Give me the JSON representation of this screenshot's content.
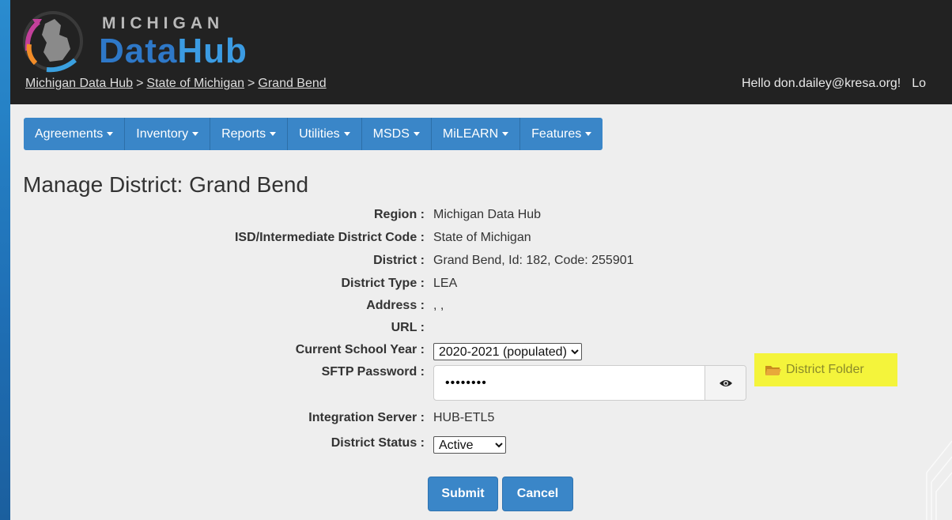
{
  "logo": {
    "line1": "MICHIGAN",
    "line2a": "Data",
    "line2b": "Hub"
  },
  "breadcrumb": {
    "items": [
      "Michigan Data Hub",
      "State of Michigan",
      "Grand Bend"
    ],
    "separator": ">"
  },
  "user": {
    "greeting": "Hello don.dailey@kresa.org!",
    "logout": "Lo"
  },
  "nav": {
    "items": [
      "Agreements",
      "Inventory",
      "Reports",
      "Utilities",
      "MSDS",
      "MiLEARN",
      "Features"
    ]
  },
  "page": {
    "title": "Manage District: Grand Bend"
  },
  "form": {
    "region": {
      "label": "Region :",
      "value": "Michigan Data Hub"
    },
    "isd": {
      "label": "ISD/Intermediate District Code :",
      "value": "State of Michigan"
    },
    "district": {
      "label": "District :",
      "value": "Grand Bend, Id: 182, Code: 255901"
    },
    "district_type": {
      "label": "District Type :",
      "value": "LEA"
    },
    "address": {
      "label": "Address :",
      "value": ", ,"
    },
    "url": {
      "label": "URL :",
      "value": ""
    },
    "school_year": {
      "label": "Current School Year :",
      "selected": "2020-2021 (populated)"
    },
    "sftp": {
      "label": "SFTP Password :",
      "masked_value": "••••••••"
    },
    "district_folder": "District Folder",
    "integration_server": {
      "label": "Integration Server :",
      "value": "HUB-ETL5"
    },
    "status": {
      "label": "District Status :",
      "selected": "Active"
    }
  },
  "buttons": {
    "submit": "Submit",
    "cancel": "Cancel"
  },
  "icons": {
    "eye": "eye-icon",
    "folder": "folder-icon",
    "caret": "caret-down-icon"
  },
  "colors": {
    "accent": "#3a86c8",
    "header_bg": "#222222",
    "highlight": "#f4f43b"
  }
}
